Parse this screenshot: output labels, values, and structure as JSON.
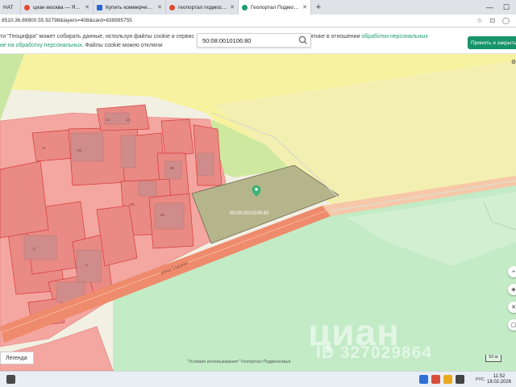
{
  "browser": {
    "tabs": [
      {
        "title": "НАТ",
        "favicon_color": "#7a7a7a",
        "active": false
      },
      {
        "title": "циан москва — Яндекс: нашлось",
        "favicon_color": "#e4482f",
        "active": false
      },
      {
        "title": "Купить коммерческий участок",
        "favicon_color": "#2b66d9",
        "active": false
      },
      {
        "title": "геопортал подмосковье — Янд",
        "favicon_color": "#e4482f",
        "active": false
      },
      {
        "title": "Геопортал Подмосковья",
        "favicon_color": "#1c9c6d",
        "active": true
      }
    ],
    "new_tab": "+",
    "url": "8510.36.89900.55.92798&layers=408&card=838995755"
  },
  "cookie_banner": {
    "line1_start": "ти \"Геоцифра\" может собирать данные, используя файлы cookie и сервис",
    "line1_end": "ятике в отношении",
    "link1": "обработки персональных",
    "line2_link": "ие на обработку персональных",
    "line2_rest": ". Файлы cookie можно отключи",
    "accept_label": "Принять и закрыть"
  },
  "search": {
    "value": "50:08:0010106:80"
  },
  "map": {
    "parcel_label": "50:08:0010106:80",
    "road_label": "улица Садовая",
    "parcel_numbers": [
      ":14",
      ":14",
      ":54",
      ":8",
      ":25",
      ":61",
      ":15",
      ":2",
      ":4"
    ]
  },
  "controls": {
    "legend_label": "Легенда",
    "terms": "\"Условия использования\" Геопортал Подмосковья",
    "scale": "50 м"
  },
  "watermark": {
    "logo": "циан",
    "id": "ID 327029864"
  },
  "taskbar": {
    "lang": "РУС",
    "time": "11:52",
    "date": "18.02.2026"
  }
}
